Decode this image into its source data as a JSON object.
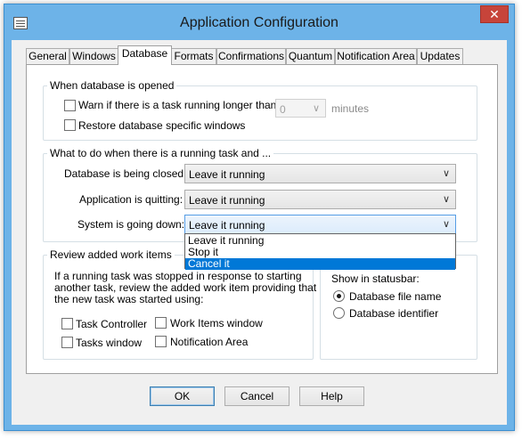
{
  "window": {
    "title": "Application Configuration",
    "close_glyph": "✕"
  },
  "tabs": [
    {
      "label": "General"
    },
    {
      "label": "Windows"
    },
    {
      "label": "Database",
      "active": true
    },
    {
      "label": "Formats"
    },
    {
      "label": "Confirmations"
    },
    {
      "label": "Quantum"
    },
    {
      "label": "Notification Area"
    },
    {
      "label": "Updates"
    }
  ],
  "when_opened": {
    "title": "When database is opened",
    "warn_label": "Warn if there is a task running longer than:",
    "warn_checked": false,
    "minutes_value": "0",
    "minutes_label": "minutes",
    "restore_label": "Restore database specific windows",
    "restore_checked": false
  },
  "running_task": {
    "title": "What to do when there is a running task and ...",
    "closed_label": "Database is being closed:",
    "closed_value": "Leave it running",
    "quitting_label": "Application is quitting:",
    "quitting_value": "Leave it running",
    "down_label": "System is going down:",
    "down_value": "Leave it running",
    "options": [
      "Leave it running",
      "Stop it",
      "Cancel it"
    ],
    "highlighted_option": "Cancel it"
  },
  "review": {
    "title": "Review added work items",
    "description_lines": [
      "If a running task was stopped in response to starting",
      "another task, review the added work item providing that",
      "the new task was started using:"
    ],
    "task_controller_label": "Task Controller",
    "work_items_label": "Work Items window",
    "tasks_window_label": "Tasks window",
    "notification_area_label": "Notification Area"
  },
  "statusbar": {
    "title": "Show in statusbar:",
    "file_name_label": "Database file name",
    "identifier_label": "Database identifier",
    "selected": "Database file name"
  },
  "buttons": {
    "ok": "OK",
    "cancel": "Cancel",
    "help": "Help"
  },
  "icons": {
    "dropdown_arrow": "∨"
  }
}
